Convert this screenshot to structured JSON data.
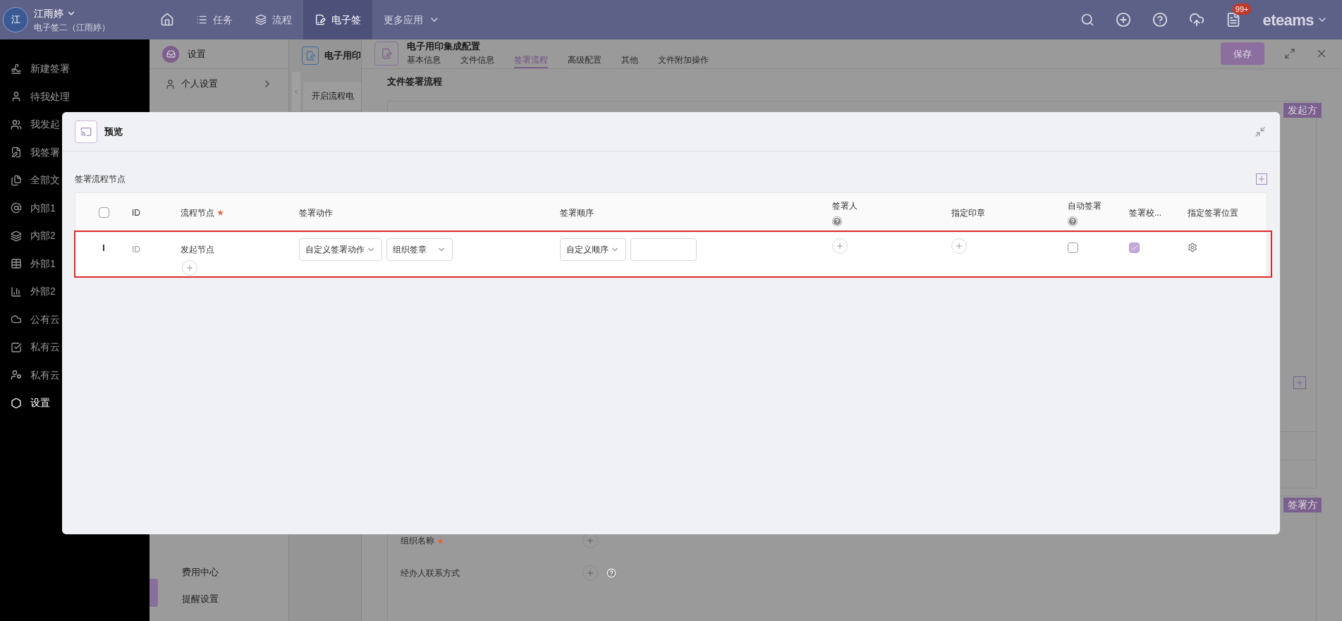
{
  "top_bar": {
    "user": {
      "avatar": "江",
      "name": "江雨婷",
      "org": "电子签二（江雨婷）"
    },
    "nav": [
      {
        "label": "任务",
        "selected": false
      },
      {
        "label": "流程",
        "selected": false
      },
      {
        "label": "电子签",
        "selected": true
      },
      {
        "label": "更多应用",
        "selected": false
      }
    ],
    "badge": "99+",
    "brand": "eteams"
  },
  "sidebar": {
    "items": [
      {
        "label": "新建签署",
        "selected": false
      },
      {
        "label": "待我处理",
        "selected": false
      },
      {
        "label": "我发起",
        "selected": false
      },
      {
        "label": "我签署",
        "selected": false
      },
      {
        "label": "全部文",
        "selected": false
      },
      {
        "label": "内部1",
        "selected": false
      },
      {
        "label": "内部2",
        "selected": false
      },
      {
        "label": "外部1",
        "selected": false
      },
      {
        "label": "外部2",
        "selected": false
      },
      {
        "label": "公有云",
        "selected": false
      },
      {
        "label": "私有云",
        "selected": false
      },
      {
        "label": "私有云",
        "selected": false
      },
      {
        "label": "设置",
        "selected": true
      }
    ]
  },
  "settings_panel": {
    "title": "设置",
    "items": [
      "个人设置"
    ],
    "bottom_items": [
      "费用中心",
      "提醒设置"
    ]
  },
  "mid_panel": {
    "title": "电子用印",
    "card_text": "开启流程电"
  },
  "config": {
    "title": "电子用印集成配置",
    "tabs": [
      {
        "label": "基本信息",
        "selected": false
      },
      {
        "label": "文件信息",
        "selected": false
      },
      {
        "label": "签署流程",
        "selected": true
      },
      {
        "label": "高级配置",
        "selected": false
      },
      {
        "label": "其他",
        "selected": false
      },
      {
        "label": "文件附加操作",
        "selected": false
      }
    ],
    "save_button": "保存",
    "section_title": "文件签署流程",
    "groups": [
      {
        "tag": "发起方"
      },
      {
        "tag": "签署方",
        "fields": [
          {
            "label": "组织名称",
            "required": true
          },
          {
            "label": "经办人联系方式",
            "help": true
          }
        ]
      }
    ]
  },
  "modal": {
    "title": "预览",
    "section_title": "签署流程节点",
    "header_checked": false,
    "columns": [
      {
        "label": "ID"
      },
      {
        "label": "流程节点",
        "required": true
      },
      {
        "label": "签署动作"
      },
      {
        "label": "签署顺序"
      },
      {
        "label": "签署人",
        "help": true
      },
      {
        "label": "指定印章"
      },
      {
        "label": "自动签署",
        "help": true
      },
      {
        "label": "签署校..."
      },
      {
        "label": "指定签署位置"
      }
    ],
    "rows": [
      {
        "highlighted": true,
        "id": "ID",
        "node": "发起节点",
        "action": "自定义签署动作",
        "seal_type": "组织签章",
        "order": "自定义顺序",
        "auto_sign": false,
        "verify": true
      }
    ]
  }
}
